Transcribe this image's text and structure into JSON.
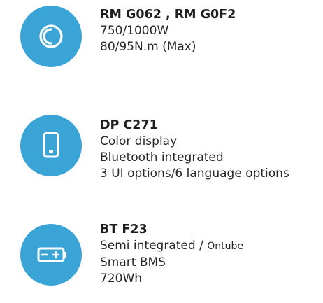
{
  "items": [
    {
      "icon": "motor-icon",
      "title": "RM G062 , RM G0F2",
      "lines": [
        "750/1000W",
        "80/95N.m (Max)"
      ]
    },
    {
      "icon": "display-icon",
      "title": "DP C271",
      "lines": [
        "Color display",
        "Bluetooth integrated",
        "3 UI options/6 language options"
      ]
    },
    {
      "icon": "battery-icon",
      "title": "BT F23",
      "line1_main": "Semi integrated /",
      "line1_small": "Ontube",
      "lines": [
        "Smart BMS",
        "720Wh"
      ]
    }
  ],
  "colors": {
    "icon_background": "#3aa4d6",
    "icon_foreground": "#ffffff",
    "text": "#262626"
  }
}
